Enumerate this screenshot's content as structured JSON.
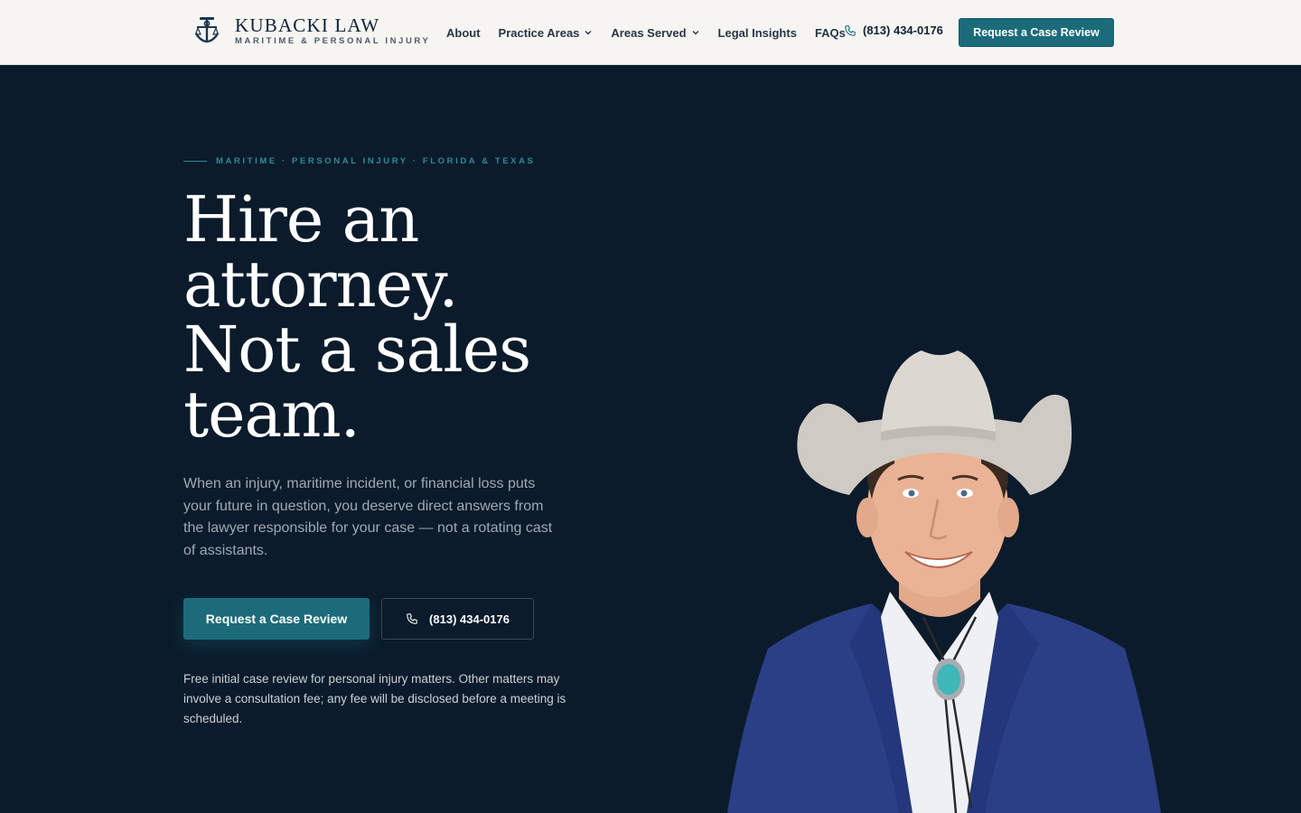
{
  "brand": {
    "name": "KUBACKI LAW",
    "tagline": "MARITIME & PERSONAL INJURY",
    "logo_icon": "anchor-scales-icon"
  },
  "nav": {
    "items": [
      {
        "label": "About",
        "has_dropdown": false
      },
      {
        "label": "Practice Areas",
        "has_dropdown": true
      },
      {
        "label": "Areas Served",
        "has_dropdown": true
      },
      {
        "label": "Legal Insights",
        "has_dropdown": false
      },
      {
        "label": "FAQs",
        "has_dropdown": false
      }
    ],
    "phone": "(813) 434-0176",
    "cta_label": "Request a Case Review"
  },
  "hero": {
    "eyebrow": "MARITIME · PERSONAL INJURY · FLORIDA & TEXAS",
    "headline_lines": [
      "Hire an",
      "attorney.",
      "Not a sales",
      "team."
    ],
    "intro": "When an injury, maritime incident, or financial loss puts your future in question, you deserve direct answers from the lawyer responsible for your case — not a rotating cast of assistants.",
    "primary_cta": "Request a Case Review",
    "phone_cta": "(813) 434-0176",
    "disclaimer": "Free initial case review for personal injury matters. Other matters may involve a consultation fee; any fee will be disclosed before a meeting is scheduled."
  },
  "colors": {
    "accent": "#1c6b7a",
    "hero_bg": "#0b1b2b",
    "header_bg": "#f6f5f2",
    "eyebrow": "#2f8a96"
  }
}
